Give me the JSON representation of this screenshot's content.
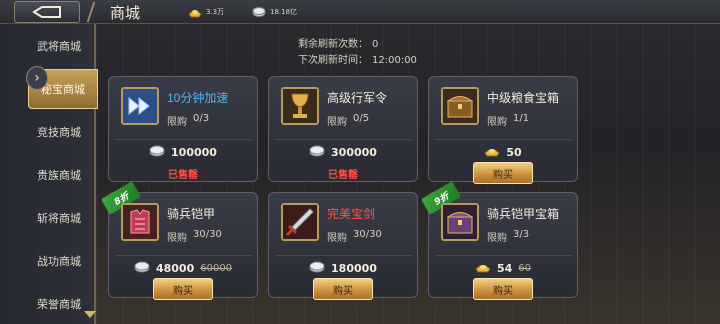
{
  "header": {
    "title": "商城",
    "resources": [
      {
        "icon": "gold-ingot-icon",
        "value": "3.3万"
      },
      {
        "icon": "silver-coin-icon",
        "value": "18.18亿"
      }
    ]
  },
  "sidebar": {
    "items": [
      {
        "label": "武将商城"
      },
      {
        "label": "秘宝商城"
      },
      {
        "label": "竞技商城"
      },
      {
        "label": "贵族商城"
      },
      {
        "label": "斩将商城"
      },
      {
        "label": "战功商城"
      },
      {
        "label": "荣誉商城"
      }
    ],
    "active_index": 1
  },
  "refresh": {
    "remaining_label": "剩余刷新次数：",
    "remaining_value": "0",
    "next_label": "下次刷新时间：",
    "next_value": "12:00:00"
  },
  "cards": [
    {
      "name": "10分钟加速",
      "name_color": "#4fb5f2",
      "limit_label": "限购",
      "limit": "0/3",
      "price_icon": "silver-coin-icon",
      "price": "100000",
      "old_price": "",
      "status": "已售罄",
      "discount": "",
      "item_icon": "speedup-arrows-icon"
    },
    {
      "name": "高级行军令",
      "name_color": "#f2eddf",
      "limit_label": "限购",
      "limit": "0/5",
      "price_icon": "silver-coin-icon",
      "price": "300000",
      "old_price": "",
      "status": "已售罄",
      "discount": "",
      "item_icon": "golden-goblet-icon"
    },
    {
      "name": "中级粮食宝箱",
      "name_color": "#f2eddf",
      "limit_label": "限购",
      "limit": "1/1",
      "price_icon": "gold-ingot-icon",
      "price": "50",
      "old_price": "",
      "status": "",
      "discount": "",
      "item_icon": "treasure-chest-icon"
    },
    {
      "name": "骑兵铠甲",
      "name_color": "#f2eddf",
      "limit_label": "限购",
      "limit": "30/30",
      "price_icon": "silver-coin-icon",
      "price": "48000",
      "old_price": "60000",
      "status": "",
      "discount": "8折",
      "item_icon": "red-armor-icon"
    },
    {
      "name": "完美宝剑",
      "name_color": "#ff5648",
      "limit_label": "限购",
      "limit": "30/30",
      "price_icon": "silver-coin-icon",
      "price": "180000",
      "old_price": "",
      "status": "",
      "discount": "",
      "item_icon": "sword-icon"
    },
    {
      "name": "骑兵铠甲宝箱",
      "name_color": "#f2eddf",
      "limit_label": "限购",
      "limit": "3/3",
      "price_icon": "gold-ingot-icon",
      "price": "54",
      "old_price": "60",
      "status": "",
      "discount": "9折",
      "item_icon": "purple-chest-icon"
    }
  ],
  "buy_label": "购买",
  "colors": {
    "accent_gold": "#d8b463",
    "sold_out_red": "#ff4d48",
    "discount_green": "#2f9a30"
  }
}
